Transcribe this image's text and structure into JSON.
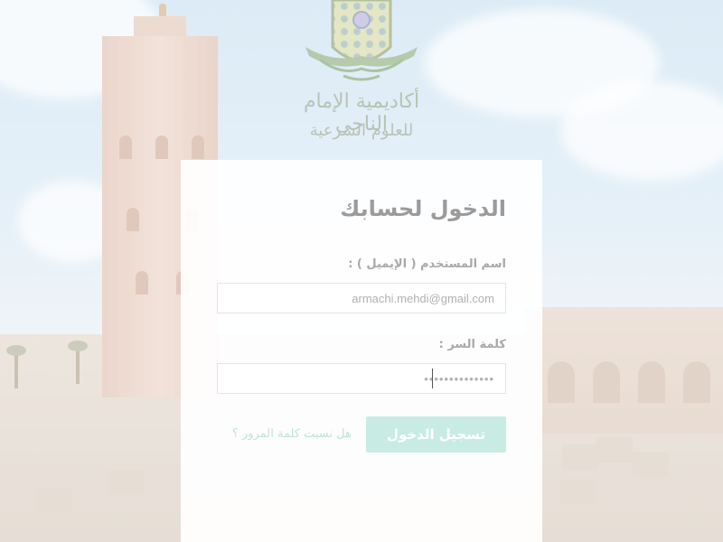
{
  "logo": {
    "line1": "أكاديمية الإمام الناجي",
    "line2": "للعلوم الشرعية",
    "icon": "academy-logo"
  },
  "login": {
    "title": "الدخول لحسابك",
    "email_label": "اسم المستخدم ( الإيميل ) :",
    "email_value": "armachi.mehdi@gmail.com",
    "password_label": "كلمة السر :",
    "password_value": "••••••••••••••",
    "submit_label": "تسجيل الدخول",
    "forgot_link": "هل نسيت كلمة المرور ؟"
  },
  "colors": {
    "accent": "#c8ece4",
    "link": "#bfe3da",
    "title": "#9b9b9b",
    "label": "#a9a9a9"
  }
}
